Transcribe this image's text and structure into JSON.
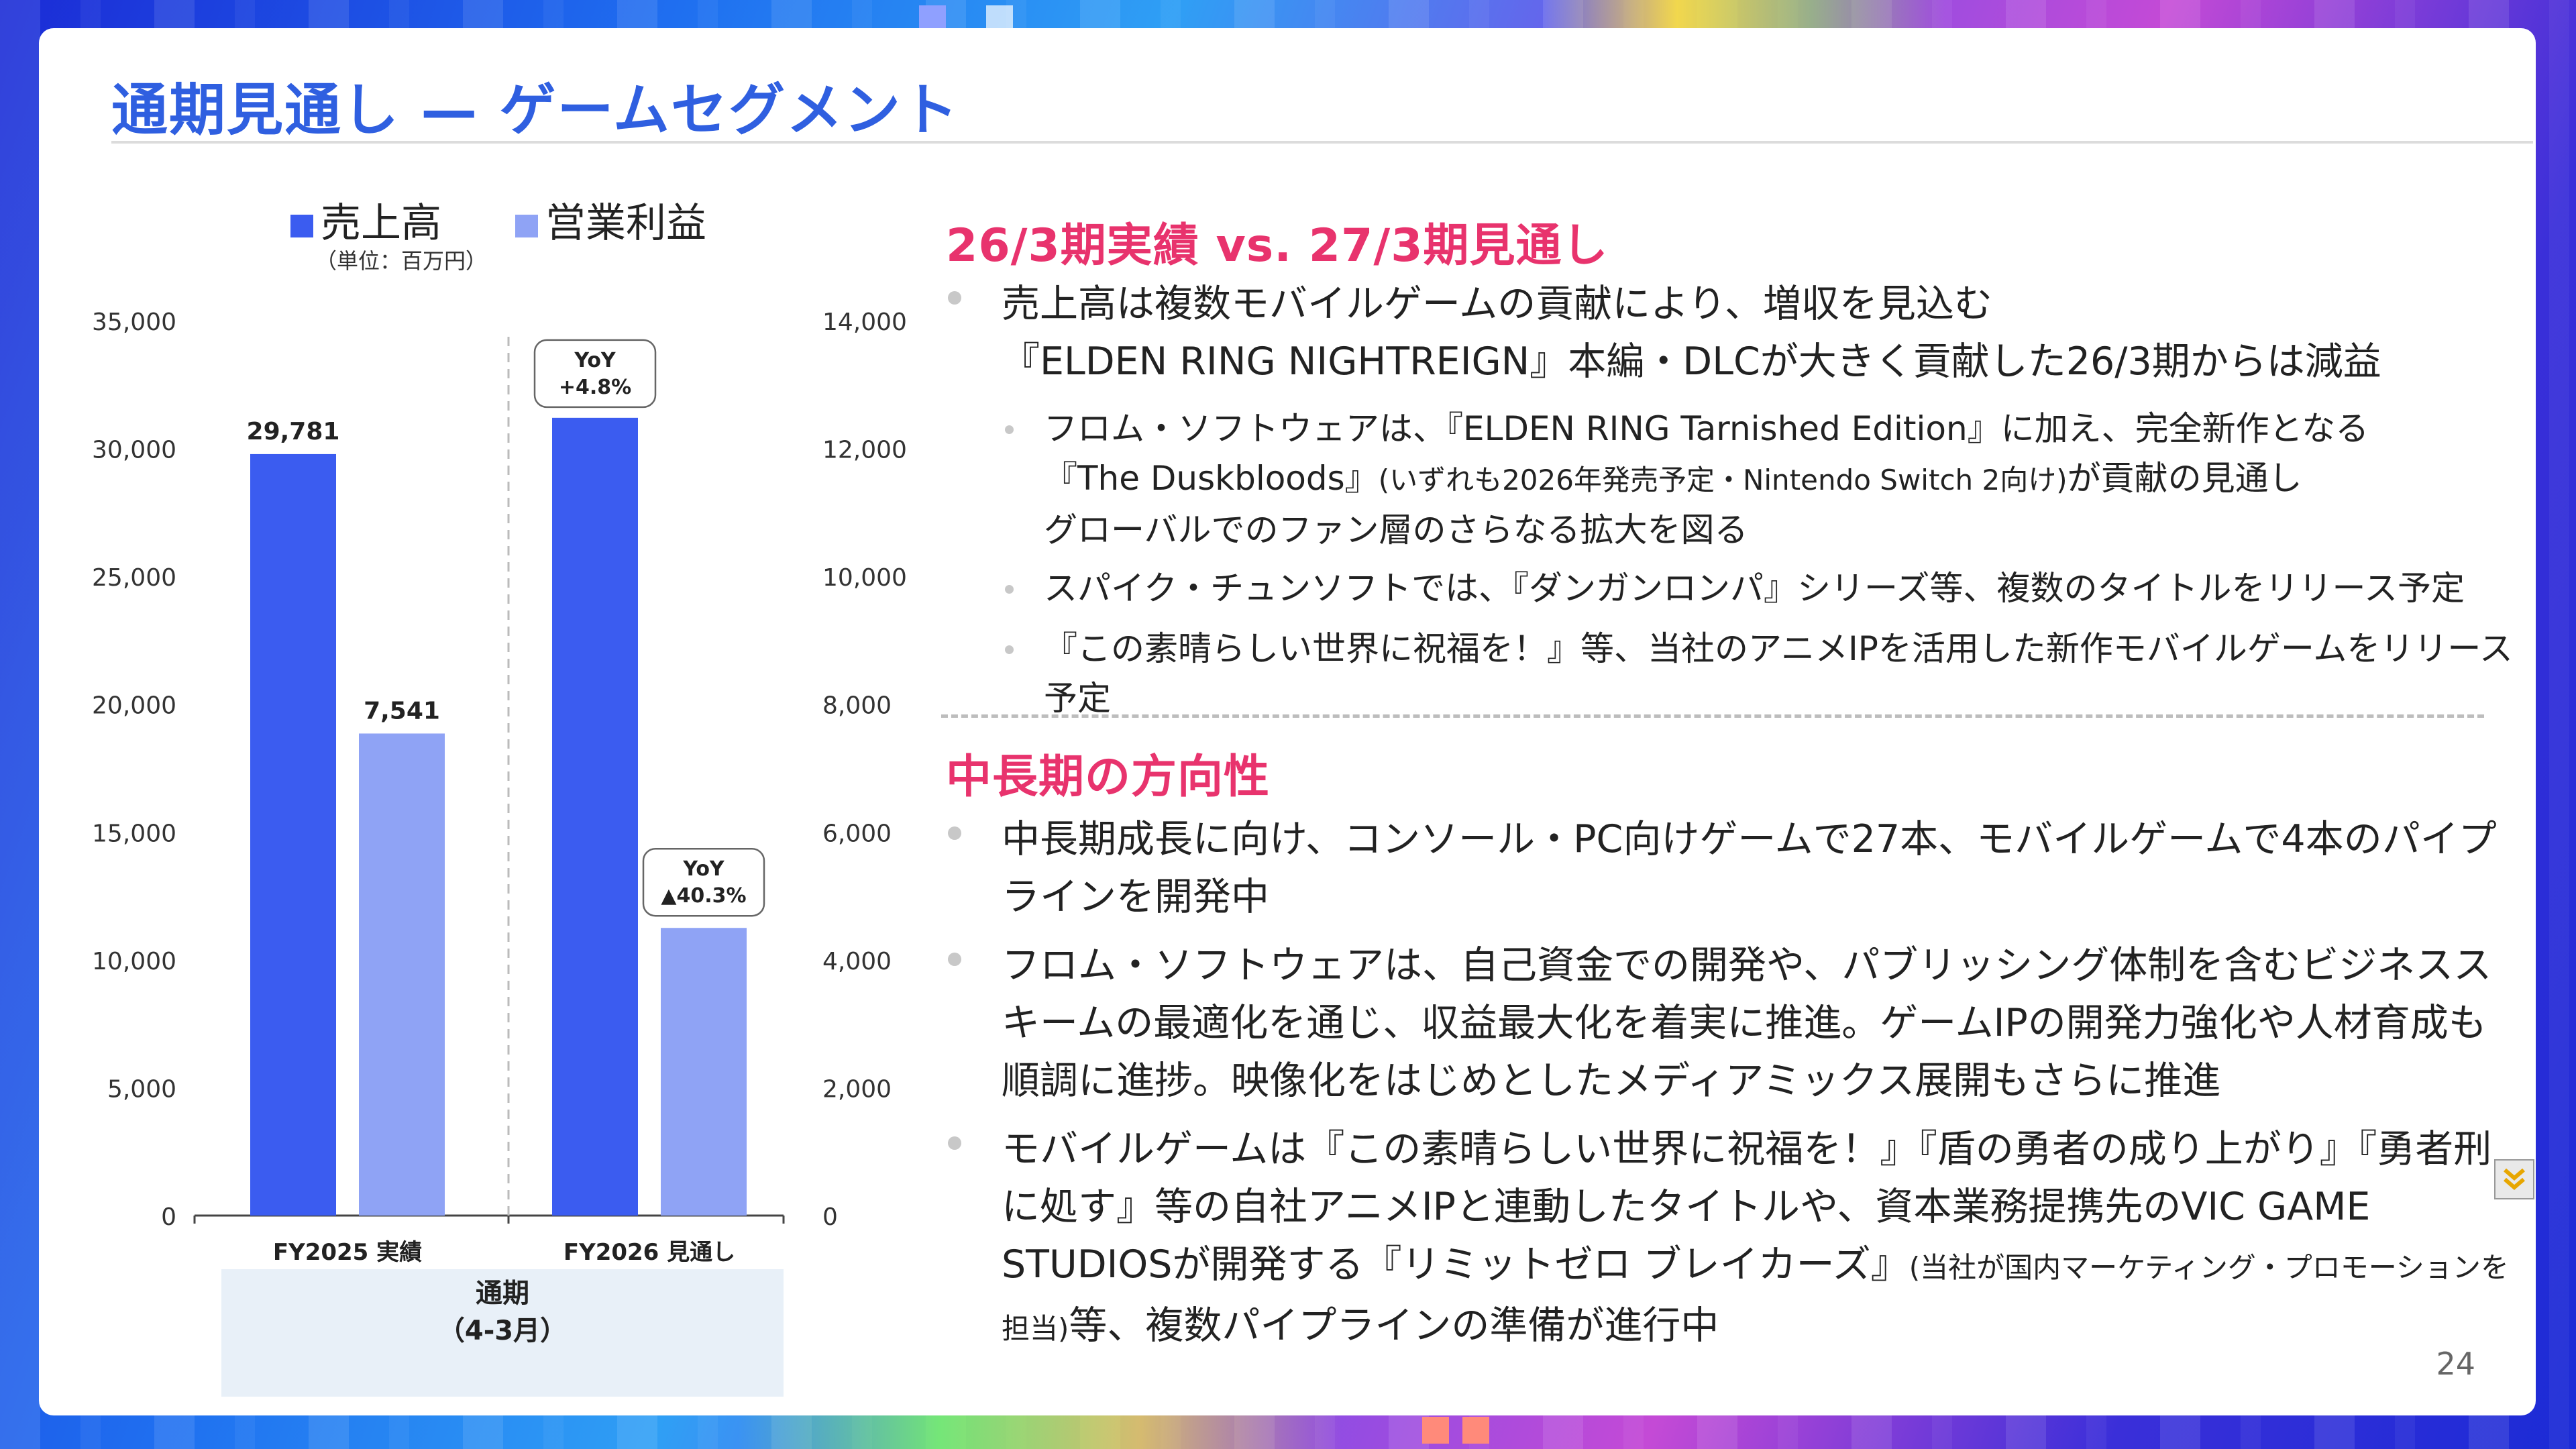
{
  "slide": {
    "title": "通期見通し — ゲームセグメント",
    "page_number": "24"
  },
  "legend": {
    "sales": "売上高",
    "op_income": "営業利益",
    "unit": "（単位：百万円）"
  },
  "period": {
    "label": "通期\n（4-3月）"
  },
  "chart_data": {
    "type": "bar",
    "categories": [
      "FY2025 実績",
      "FY2026 見通し"
    ],
    "series": [
      {
        "name": "売上高",
        "values": [
          29781,
          31200
        ],
        "axis": "left",
        "color": "#3b5cf0",
        "labels": [
          "29,781",
          "31,200"
        ]
      },
      {
        "name": "営業利益",
        "values": [
          7541,
          4500
        ],
        "axis": "right",
        "color": "#8fa3f5",
        "labels": [
          "7,541",
          "4,500"
        ]
      }
    ],
    "left_axis": {
      "min": 0,
      "max": 35000,
      "ticks": [
        "0",
        "5,000",
        "10,000",
        "15,000",
        "20,000",
        "25,000",
        "30,000",
        "35,000"
      ]
    },
    "right_axis": {
      "min": 0,
      "max": 14000,
      "ticks": [
        "0",
        "2,000",
        "4,000",
        "6,000",
        "8,000",
        "10,000",
        "12,000",
        "14,000"
      ]
    },
    "annotations": [
      {
        "series": 0,
        "category": 1,
        "text1": "YoY",
        "text2": "+4.8%"
      },
      {
        "series": 1,
        "category": 1,
        "text1": "YoY",
        "text2": "▲40.3%"
      }
    ]
  },
  "right": {
    "heading1": "26/3期実績 vs. 27/3期見通し",
    "b1_line1": "売上高は複数モバイルゲームの貢献により、増収を見込む",
    "b1_line2": "『ELDEN RING NIGHTREIGN』本編・DLCが大きく貢献した26/3期からは減益",
    "s1_part1": "フロム・ソフトウェアは、『ELDEN RING Tarnished Edition』に加え、完全新作となる『The Duskbloods』",
    "s1_small": "(いずれも2026年発売予定・Nintendo Switch 2向け)",
    "s1_part2": "が貢献の見通し",
    "s1_line3": "グローバルでのファン層のさらなる拡大を図る",
    "s2": "スパイク・チュンソフトでは、『ダンガンロンパ』シリーズ等、複数のタイトルをリリース予定",
    "s3": "『この素晴らしい世界に祝福を！』等、当社のアニメIPを活用した新作モバイルゲームをリリース予定",
    "heading2": "中長期の方向性",
    "m1": "中長期成長に向け、コンソール・PC向けゲームで27本、モバイルゲームで4本のパイプラインを開発中",
    "m2": "フロム・ソフトウェアは、自己資金での開発や、パブリッシング体制を含むビジネススキームの最適化を通じ、収益最大化を着実に推進。ゲームIPの開発力強化や人材育成も順調に進捗。映像化をはじめとしたメディアミックス展開もさらに推進",
    "m3_part1": "モバイルゲームは『この素晴らしい世界に祝福を！』『盾の勇者の成り上がり』『勇者刑に処す』等の自社アニメIPと連動したタイトルや、資本業務提携先のVIC GAME STUDIOSが開発する『リミットゼロ ブレイカーズ』",
    "m3_small": "(当社が国内マーケティング・プロモーションを担当)",
    "m3_part2": "等、複数パイプラインの準備が進行中"
  }
}
